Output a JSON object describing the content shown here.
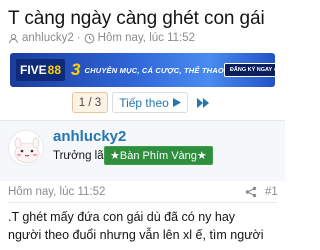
{
  "thread": {
    "title": "T càng ngày càng ghét con gái",
    "author": "anhlucky2",
    "timestamp": "Hôm nay, lúc 11:52"
  },
  "banner": {
    "logo_five": "FIVE",
    "logo_88": "88",
    "logo_sub": ".com",
    "number": "3",
    "text": "CHUYÊN MỤC, CÁ CƯỢC, THỂ THAO",
    "cta": "ĐĂNG KÝ NGAY ›"
  },
  "pagination": {
    "current": "1 / 3",
    "next_label": "Tiếp theo",
    "next_icon": "triangle-right-icon",
    "last_icon": "double-chevron-right-icon"
  },
  "post": {
    "author": "anhlucky2",
    "user_title": "Trưởng lão",
    "badge": "★Bàn Phím Vàng★",
    "date": "Hôm nay, lúc 11:52",
    "number": "#1",
    "body_lines": [
      ".T ghét mấy đứa con gái dù đã có ny hay",
      "người theo đuổi nhưng vẫn lên xl ế, tìm người"
    ]
  },
  "colors": {
    "link_blue": "#2577b1",
    "badge_green": "#2f8f3f",
    "muted": "#8c8c8c"
  }
}
